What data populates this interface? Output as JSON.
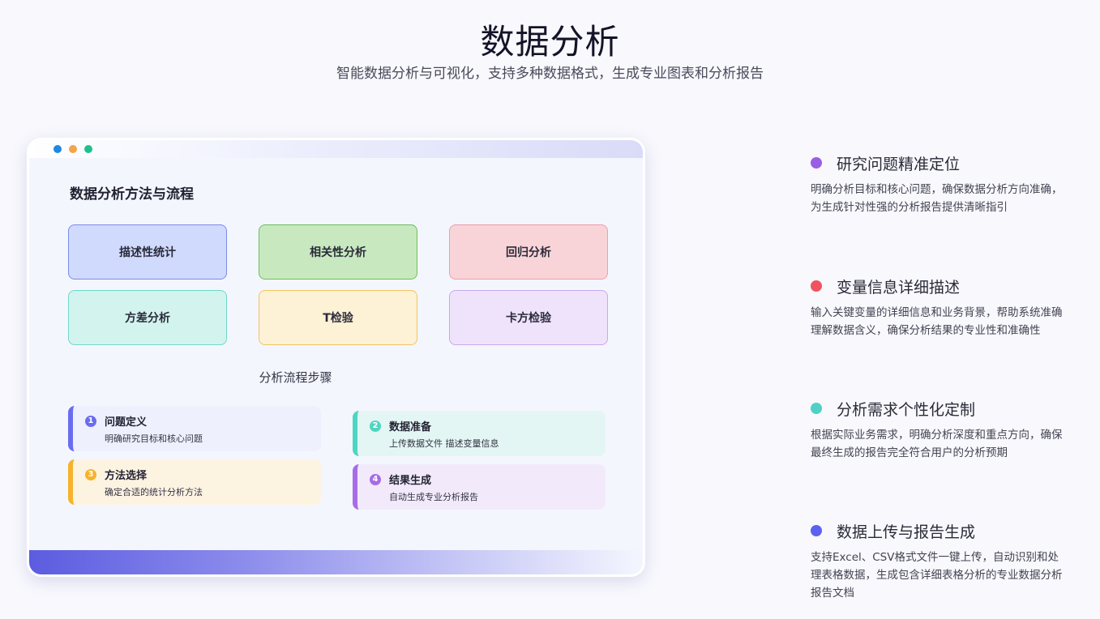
{
  "header": {
    "title": "数据分析",
    "subtitle": "智能数据分析与可视化，支持多种数据格式，生成专业图表和分析报告"
  },
  "card": {
    "heading": "数据分析方法与流程",
    "methods": [
      "描述性统计",
      "相关性分析",
      "回归分析",
      "方差分析",
      "T检验",
      "卡方检验"
    ],
    "steps_heading": "分析流程步骤",
    "steps": [
      {
        "num": "1",
        "title": "问题定义",
        "desc": "明确研究目标和核心问题"
      },
      {
        "num": "2",
        "title": "数据准备",
        "desc": "上传数据文件 描述变量信息"
      },
      {
        "num": "3",
        "title": "方法选择",
        "desc": "确定合适的统计分析方法"
      },
      {
        "num": "4",
        "title": "结果生成",
        "desc": "自动生成专业分析报告"
      }
    ]
  },
  "features": [
    {
      "title": "研究问题精准定位",
      "desc": "明确分析目标和核心问题，确保数据分析方向准确，为生成针对性强的分析报告提供清晰指引",
      "color": "#9b5de5"
    },
    {
      "title": "变量信息详细描述",
      "desc": "输入关键变量的详细信息和业务背景，帮助系统准确理解数据含义，确保分析结果的专业性和准确性",
      "color": "#ef5360"
    },
    {
      "title": "分析需求个性化定制",
      "desc": "根据实际业务需求，明确分析深度和重点方向，确保最终生成的报告完全符合用户的分析预期",
      "color": "#4fd1c5"
    },
    {
      "title": "数据上传与报告生成",
      "desc": "支持Excel、CSV格式文件一键上传，自动识别和处理表格数据，生成包含详细表格分析的专业数据分析报告文档",
      "color": "#5b62ef"
    }
  ],
  "colors": {
    "accent": "#5b5ce0",
    "window_dots": [
      "#1e88e5",
      "#f4a44a",
      "#1fc08e"
    ]
  }
}
